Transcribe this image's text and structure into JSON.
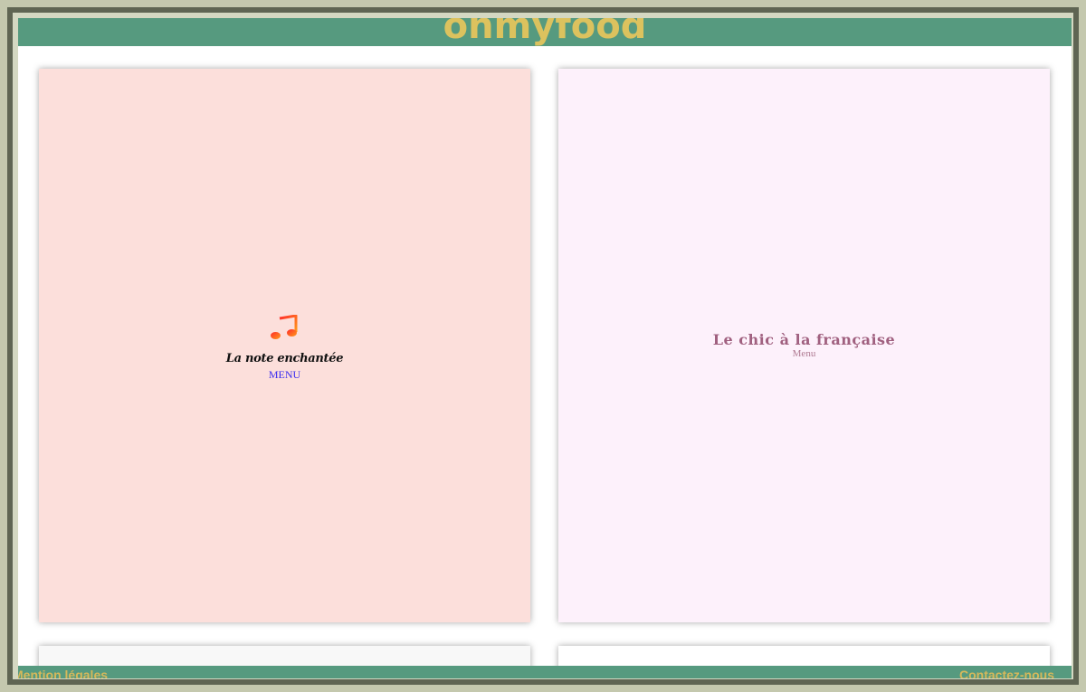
{
  "header": {
    "brand": "ohmyfood"
  },
  "restaurants": [
    {
      "name": "La note enchantée",
      "link": "MENU",
      "icon": "music-note-icon",
      "background": "#fcdfdb"
    },
    {
      "name": "Le chic à la française",
      "link": "Menu",
      "background": "#fdf1fb"
    },
    {
      "background": "#f8f8f8"
    },
    {
      "background": "#ffffff"
    }
  ],
  "footer": {
    "left_link": "Mention légales",
    "right_link": "Contactez-nous"
  },
  "colors": {
    "header_bg": "#569a7f",
    "brand": "#dcc25e",
    "frame": "#c4c8ae"
  }
}
